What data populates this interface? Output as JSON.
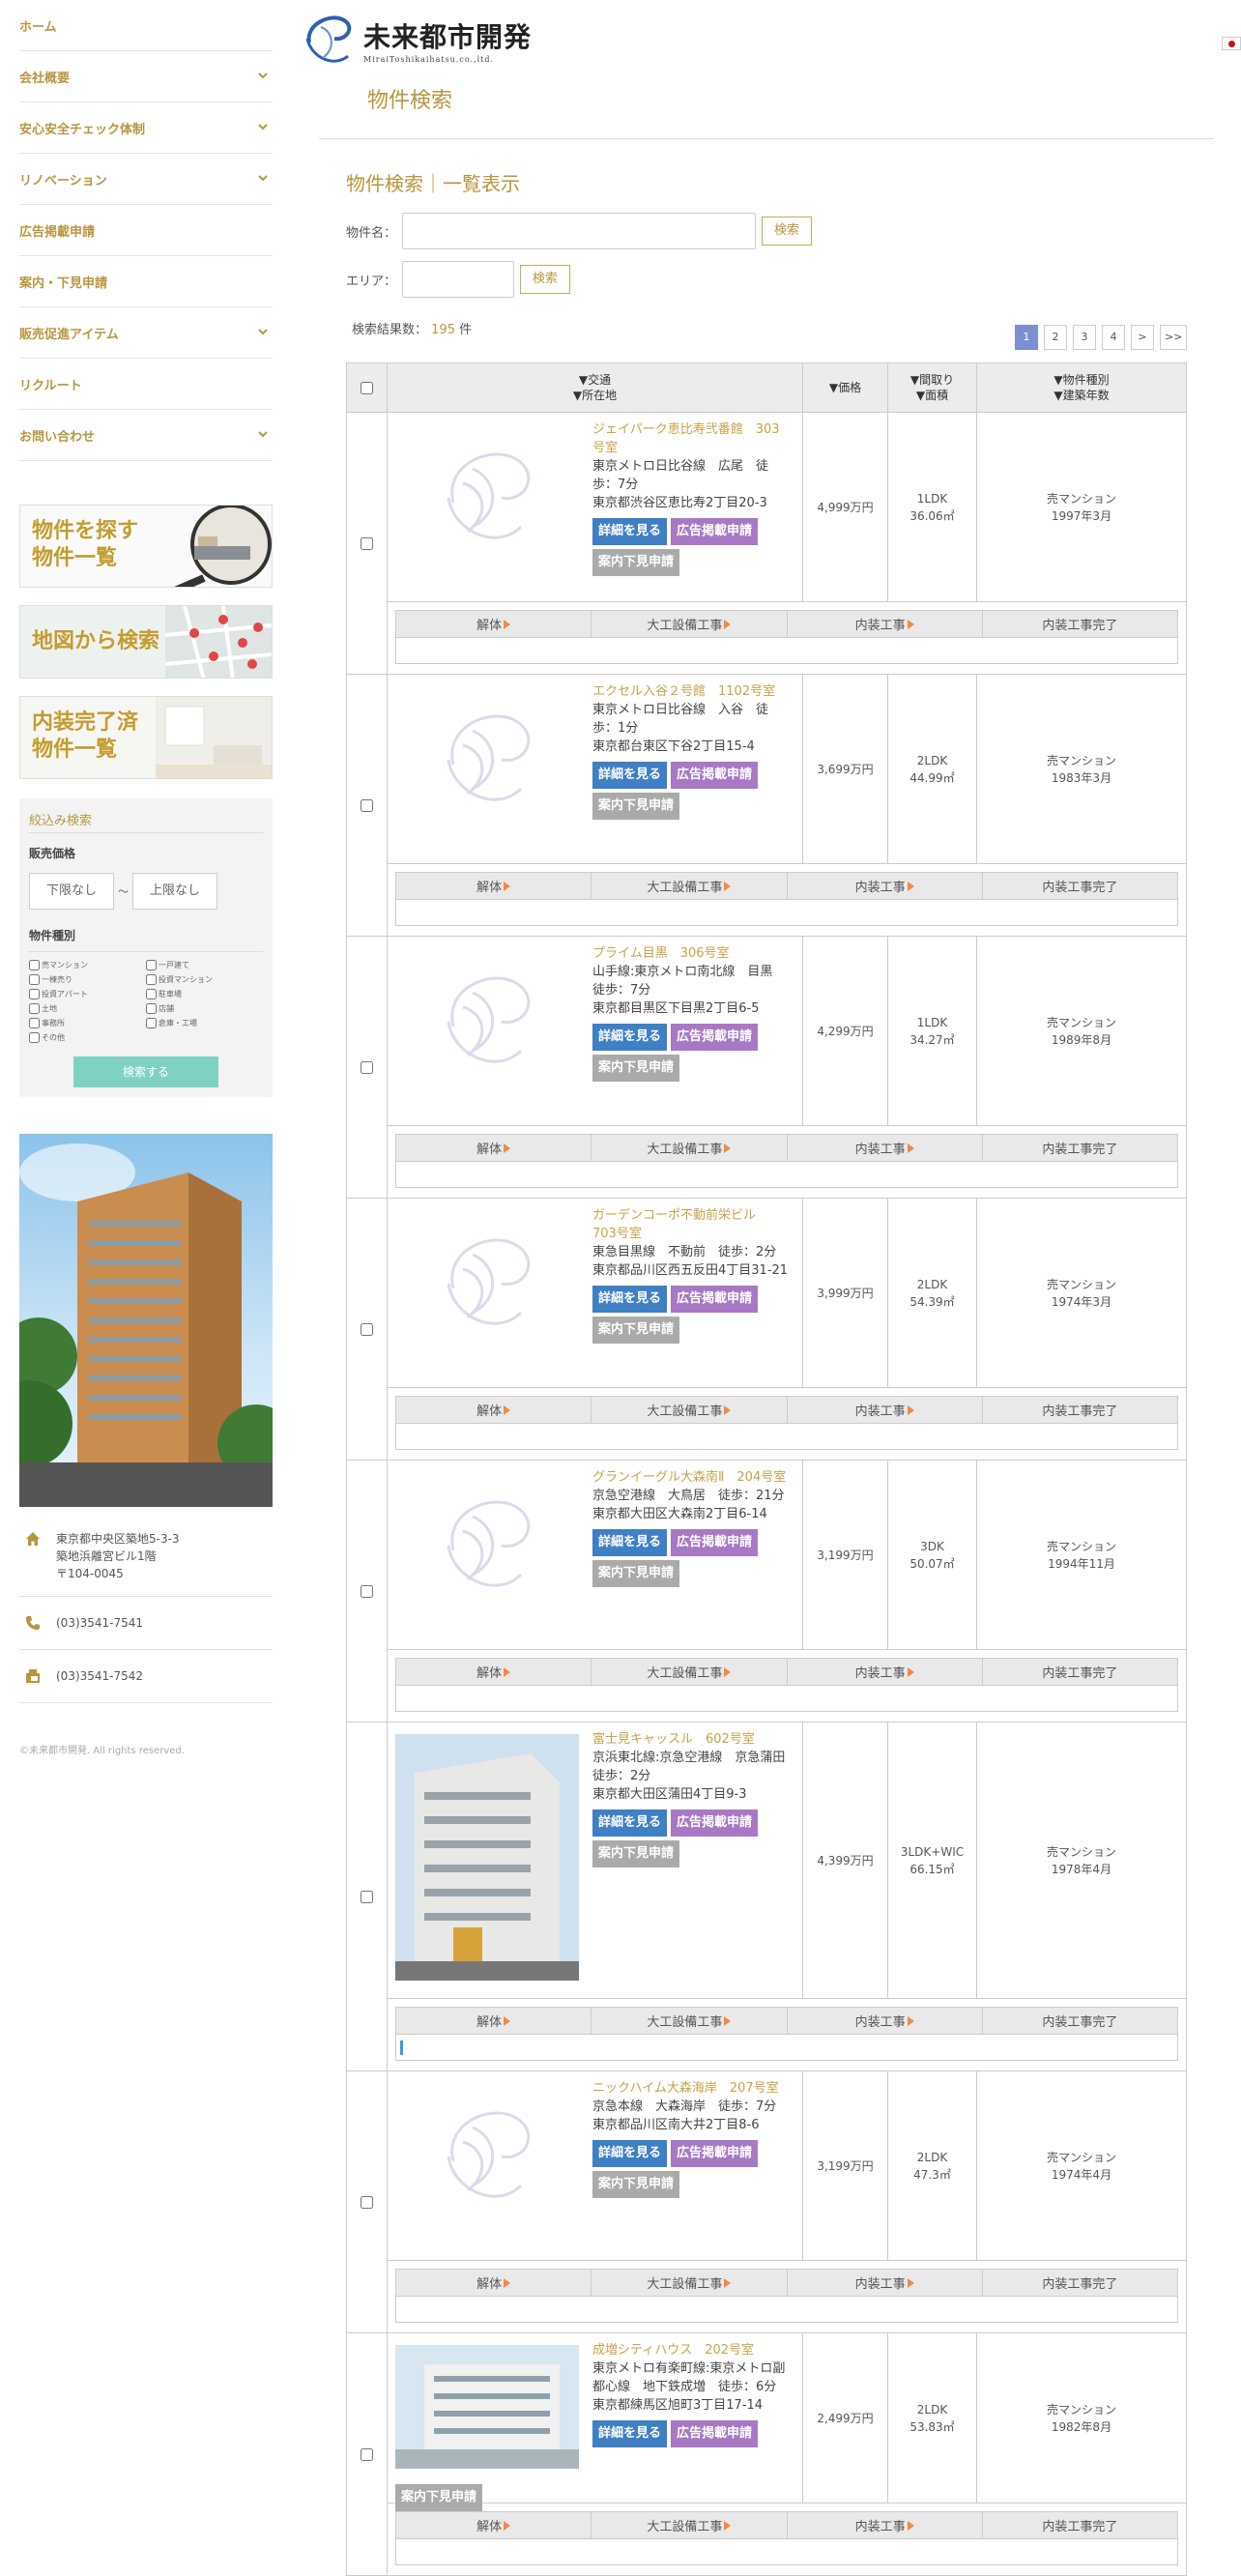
{
  "nav": [
    {
      "label": "ホーム",
      "chevron": false
    },
    {
      "label": "会社概要",
      "chevron": true
    },
    {
      "label": "安心安全チェック体制",
      "chevron": true
    },
    {
      "label": "リノベーション",
      "chevron": true
    },
    {
      "label": "広告掲載申請",
      "chevron": false
    },
    {
      "label": "案内・下見申請",
      "chevron": false
    },
    {
      "label": "販売促進アイテム",
      "chevron": true
    },
    {
      "label": "リクルート",
      "chevron": false
    },
    {
      "label": "お問い合わせ",
      "chevron": true
    }
  ],
  "banners": {
    "search": "物件を探す\n物件一覧",
    "map": "地図から検索",
    "finished": "内装完了済\n物件一覧"
  },
  "filter": {
    "title": "絞込み検索",
    "price_label": "販売価格",
    "min": "下限なし",
    "sep": "～",
    "max": "上限なし",
    "type_label": "物件種別",
    "types": [
      "売マンション",
      "一戸建て",
      "一棟売り",
      "投資マンション",
      "投資アパート",
      "駐車場",
      "土地",
      "店舗",
      "事務所",
      "倉庫・工場",
      "その他"
    ],
    "search_button": "検索する"
  },
  "contact": {
    "address": "東京都中央区築地5-3-3\n築地浜離宮ビル1階\n〒104-0045",
    "tel": "(03)3541-7541",
    "fax": "(03)3541-7542"
  },
  "copyright": "©未来都市開発. All rights reserved.",
  "header": {
    "company": "未来都市開発",
    "company_en": "MiraiToshikaihatsu.co.,ltd.",
    "page_title": "物件検索"
  },
  "search": {
    "section_title": "物件検索｜一覧表示",
    "name_label": "物件名：",
    "area_label": "エリア：",
    "button": "検索",
    "result_prefix": "検索結果数：",
    "result_count": "195",
    "result_suffix": "件"
  },
  "pager": [
    "1",
    "2",
    "3",
    "4",
    ">",
    ">>"
  ],
  "table_head": {
    "transport": "▼交通\n▼所在地",
    "price": "▼価格",
    "layout": "▼間取り\n▼面積",
    "type": "▼物件種別\n▼建築年数"
  },
  "stages": [
    "解体",
    "大工設備工事",
    "内装工事",
    "内装工事完了"
  ],
  "buttons": {
    "detail": "詳細を見る",
    "ad": "広告掲載申請",
    "view": "案内下見申請"
  },
  "properties": [
    {
      "name": "ジェイパーク恵比寿弐番館　303号室",
      "line": "東京メトロ日比谷線　広尾　徒歩：7分",
      "addr": "東京都渋谷区恵比寿2丁目20-3",
      "price": "4,999万円",
      "layout": "1LDK",
      "area": "36.06㎡",
      "type": "売マンション",
      "built": "1997年3月",
      "photo": false,
      "progress": 0
    },
    {
      "name": "エクセル入谷２号館　1102号室",
      "line": "東京メトロ日比谷線　入谷　徒歩：1分",
      "addr": "東京都台東区下谷2丁目15-4",
      "price": "3,699万円",
      "layout": "2LDK",
      "area": "44.99㎡",
      "type": "売マンション",
      "built": "1983年3月",
      "photo": false,
      "progress": 0
    },
    {
      "name": "プライム目黒　306号室",
      "line": "山手線:東京メトロ南北線　目黒　徒歩：7分",
      "addr": "東京都目黒区下目黒2丁目6-5",
      "price": "4,299万円",
      "layout": "1LDK",
      "area": "34.27㎡",
      "type": "売マンション",
      "built": "1989年8月",
      "photo": false,
      "progress": 0
    },
    {
      "name": "ガーデンコーポ不動前栄ビル　703号室",
      "line": "東急目黒線　不動前　徒歩：2分",
      "addr": "東京都品川区西五反田4丁目31-21",
      "price": "3,999万円",
      "layout": "2LDK",
      "area": "54.39㎡",
      "type": "売マンション",
      "built": "1974年3月",
      "photo": false,
      "progress": 0
    },
    {
      "name": "グランイーグル大森南Ⅱ　204号室",
      "line": "京急空港線　大鳥居　徒歩：21分",
      "addr": "東京都大田区大森南2丁目6-14",
      "price": "3,199万円",
      "layout": "3DK",
      "area": "50.07㎡",
      "type": "売マンション",
      "built": "1994年11月",
      "photo": false,
      "progress": 0
    },
    {
      "name": "富士見キャッスル　602号室",
      "line": "京浜東北線:京急空港線　京急蒲田　徒歩：2分",
      "addr": "東京都大田区蒲田4丁目9-3",
      "price": "4,399万円",
      "layout": "3LDK+WIC",
      "area": "66.15㎡",
      "type": "売マンション",
      "built": "1978年4月",
      "photo": true,
      "progress": 0.01
    },
    {
      "name": "ニックハイム大森海岸　207号室",
      "line": "京急本線　大森海岸　徒歩：7分",
      "addr": "東京都品川区南大井2丁目8-6",
      "price": "3,199万円",
      "layout": "2LDK",
      "area": "47.3㎡",
      "type": "売マンション",
      "built": "1974年4月",
      "photo": false,
      "progress": 0
    },
    {
      "name": "成増シティハウス　202号室",
      "line": "東京メトロ有楽町線:東京メトロ副都心線　地下鉄成増　徒歩：6分",
      "addr": "東京都練馬区旭町3丁目17-14",
      "price": "2,499万円",
      "layout": "2LDK",
      "area": "53.83㎡",
      "type": "売マンション",
      "built": "1982年8月",
      "photo": true,
      "progress": 0
    }
  ],
  "colors": {
    "gold": "#b8963f",
    "detail": "#3f7fc4",
    "ad": "#a779c4",
    "view": "#aaaaaa",
    "arrow": "#f08a45"
  }
}
